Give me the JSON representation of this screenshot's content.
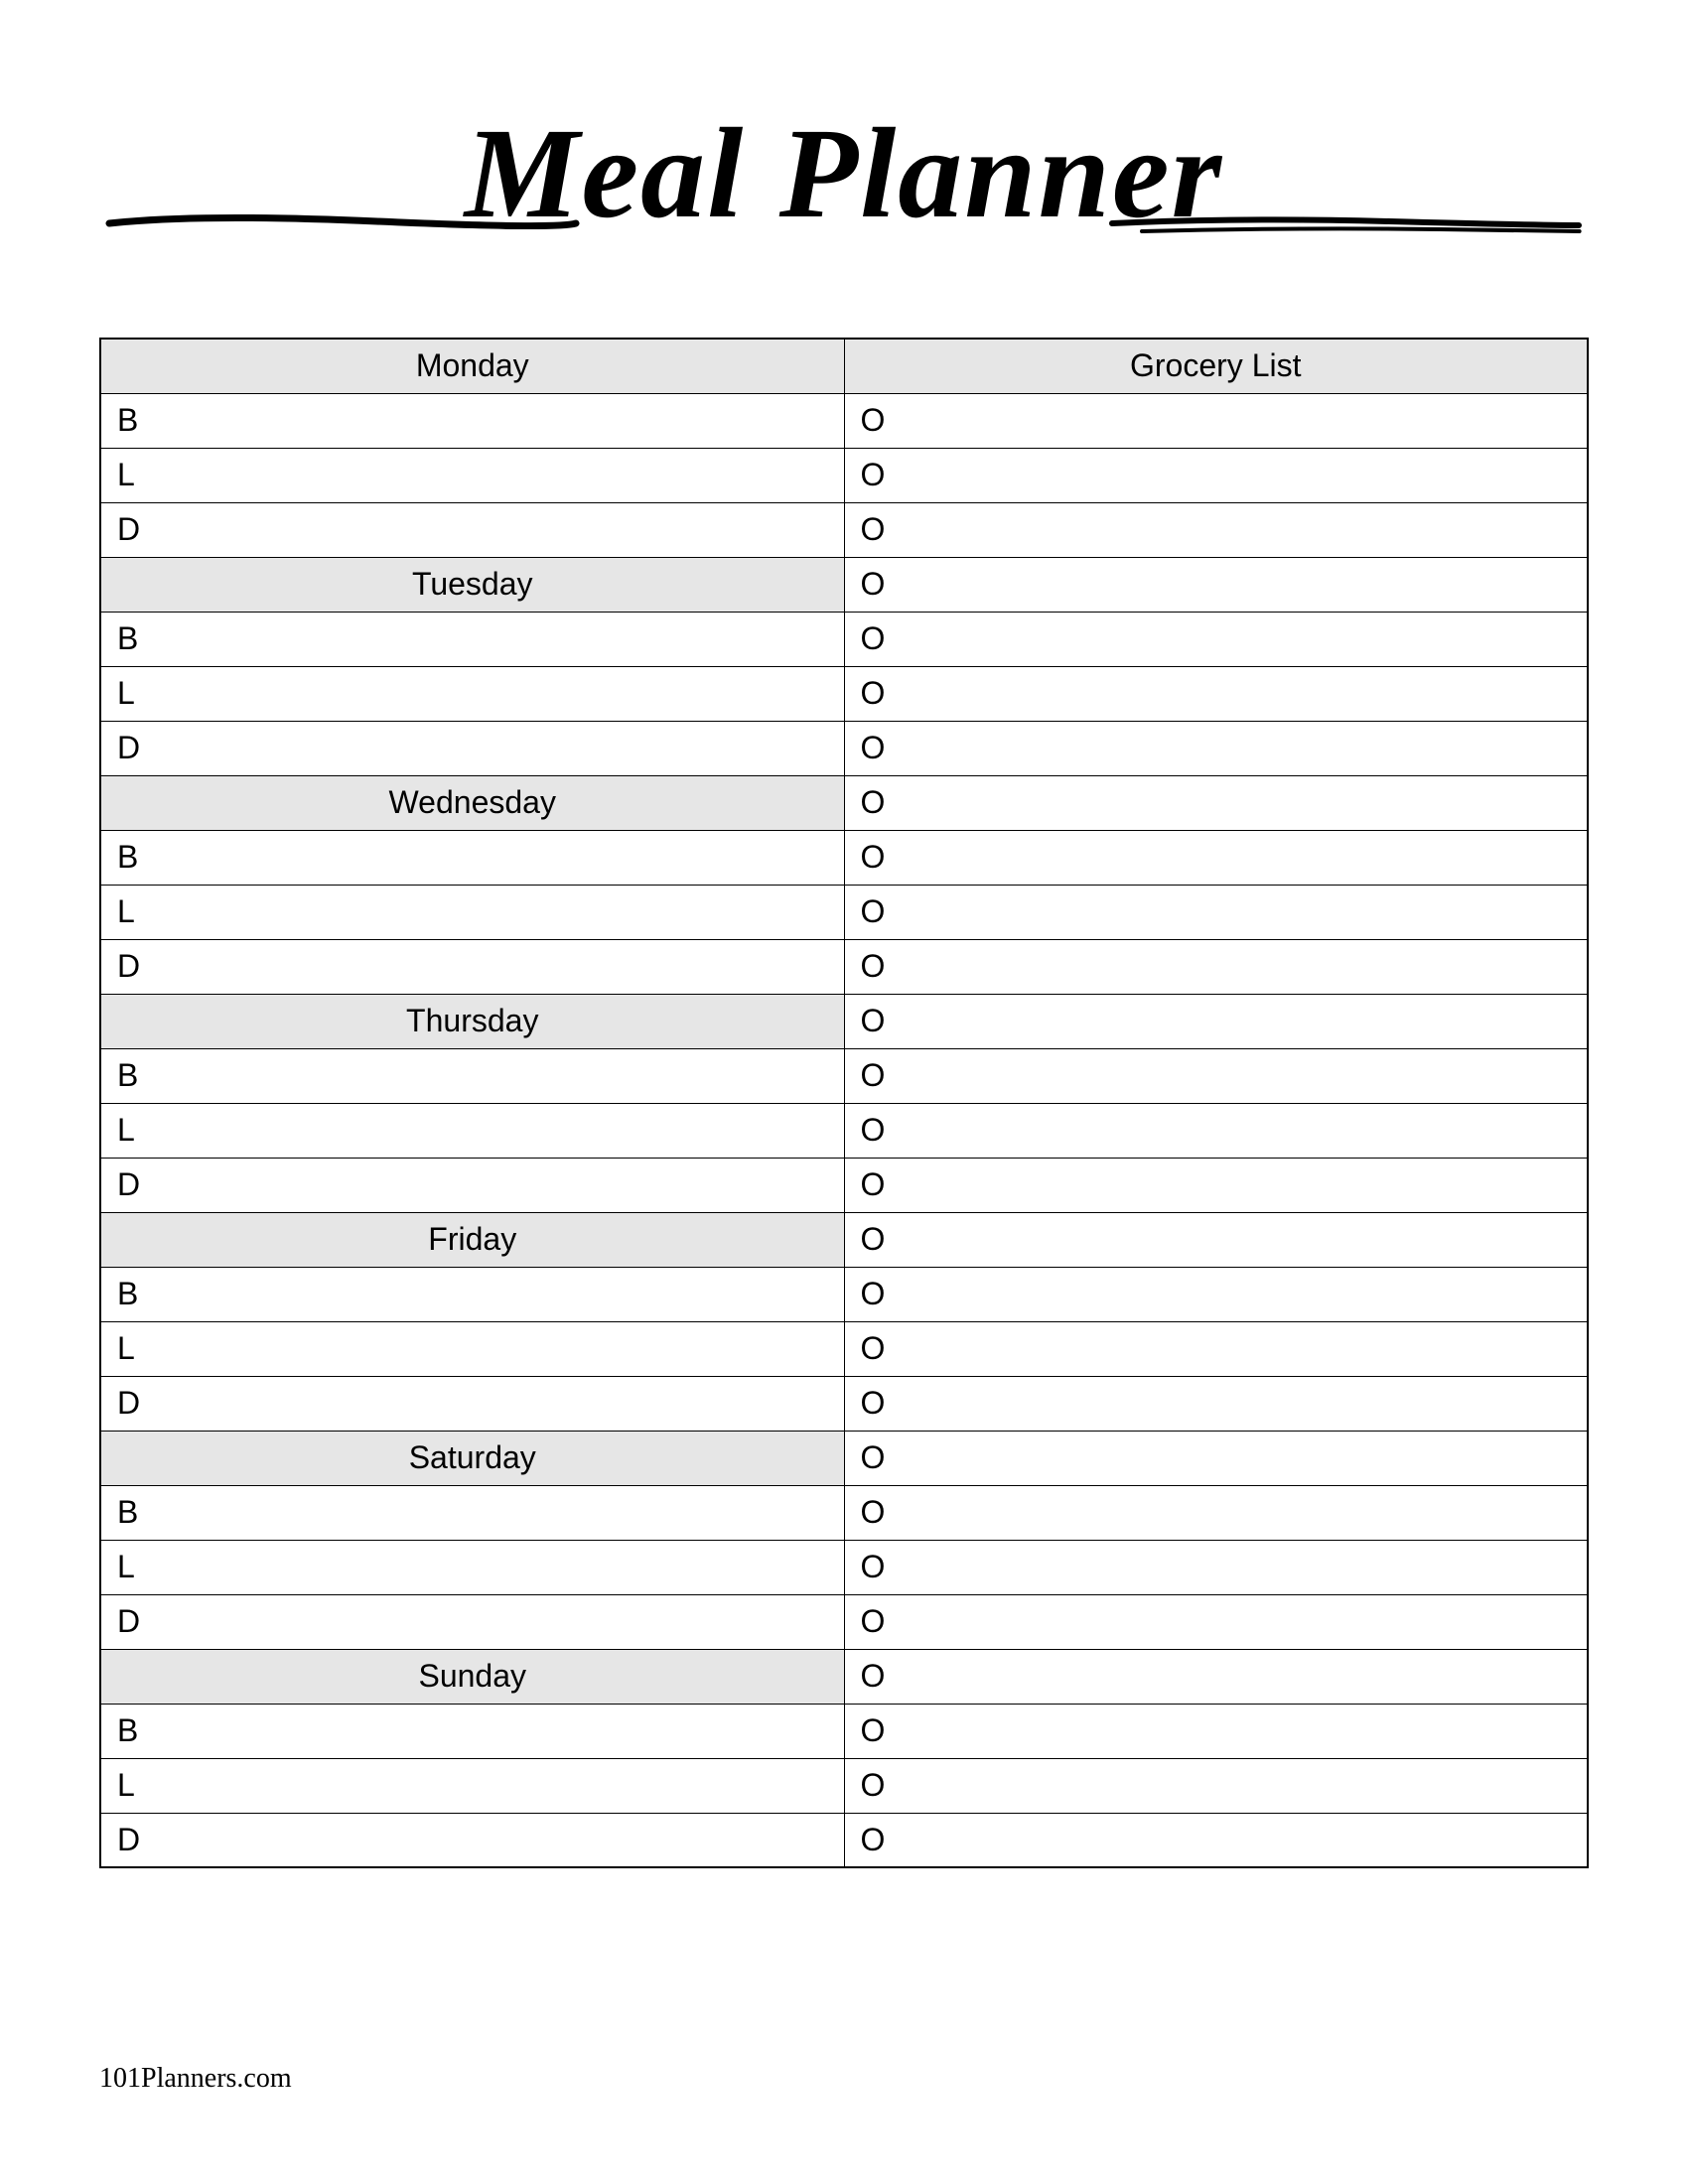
{
  "title": "Meal Planner",
  "groceryHeader": "Grocery List",
  "days": [
    "Monday",
    "Tuesday",
    "Wednesday",
    "Thursday",
    "Friday",
    "Saturday",
    "Sunday"
  ],
  "meals": [
    "B",
    "L",
    "D"
  ],
  "groceryBullet": "O",
  "footer": "101Planners.com"
}
